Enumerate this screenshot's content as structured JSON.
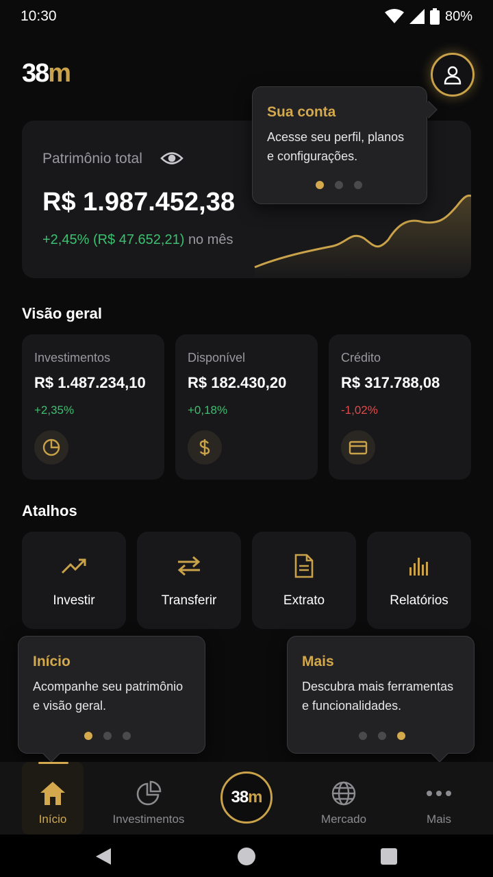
{
  "status": {
    "time": "10:30",
    "battery": "80%"
  },
  "header": {
    "logo_prefix": "38",
    "logo_suffix": "m"
  },
  "wealth": {
    "label": "Patrimônio total",
    "value": "R$ 1.987.452,38",
    "change": "+2,45% (R$ 47.652,21)",
    "period": "no mês"
  },
  "overview": {
    "title": "Visão geral",
    "cards": [
      {
        "label": "Investimentos",
        "value": "R$ 1.487.234,10",
        "change": "+2,35%",
        "icon": "pie-chart-icon"
      },
      {
        "label": "Disponível",
        "value": "R$ 182.430,20",
        "change": "+0,18%",
        "icon": "dollar-icon"
      },
      {
        "label": "Crédito",
        "value": "R$ 317.788,08",
        "change": "-1,02%",
        "icon": "credit-card-icon"
      }
    ]
  },
  "shortcuts": {
    "title": "Atalhos",
    "items": [
      {
        "label": "Investir",
        "icon": "trending-up-icon"
      },
      {
        "label": "Transferir",
        "icon": "transfer-icon"
      },
      {
        "label": "Extrato",
        "icon": "statement-icon"
      },
      {
        "label": "Relatórios",
        "icon": "bar-chart-icon"
      }
    ]
  },
  "tooltips": {
    "account": {
      "title": "Sua conta",
      "body1": "Acesse seu perfil, planos",
      "body2": "e configurações."
    },
    "home": {
      "title": "Início",
      "body1": "Acompanhe seu patrimônio",
      "body2": "e visão geral."
    },
    "more": {
      "title": "Mais",
      "body1": "Descubra mais ferramentas",
      "body2": "e funcionalidades."
    }
  },
  "nav": {
    "items": [
      {
        "label": "Início",
        "icon": "home-icon"
      },
      {
        "label": "Investimentos",
        "icon": "pie-chart-icon"
      },
      {
        "label": "Mercado",
        "icon": "globe-icon"
      },
      {
        "label": "Mais",
        "icon": "more-icon"
      }
    ],
    "center_prefix": "38",
    "center_suffix": "m"
  },
  "colors": {
    "accent": "#c9a24a",
    "positive": "#3cc070",
    "negative": "#e24a4a",
    "background": "#0b0b0c",
    "card": "#18181a"
  }
}
